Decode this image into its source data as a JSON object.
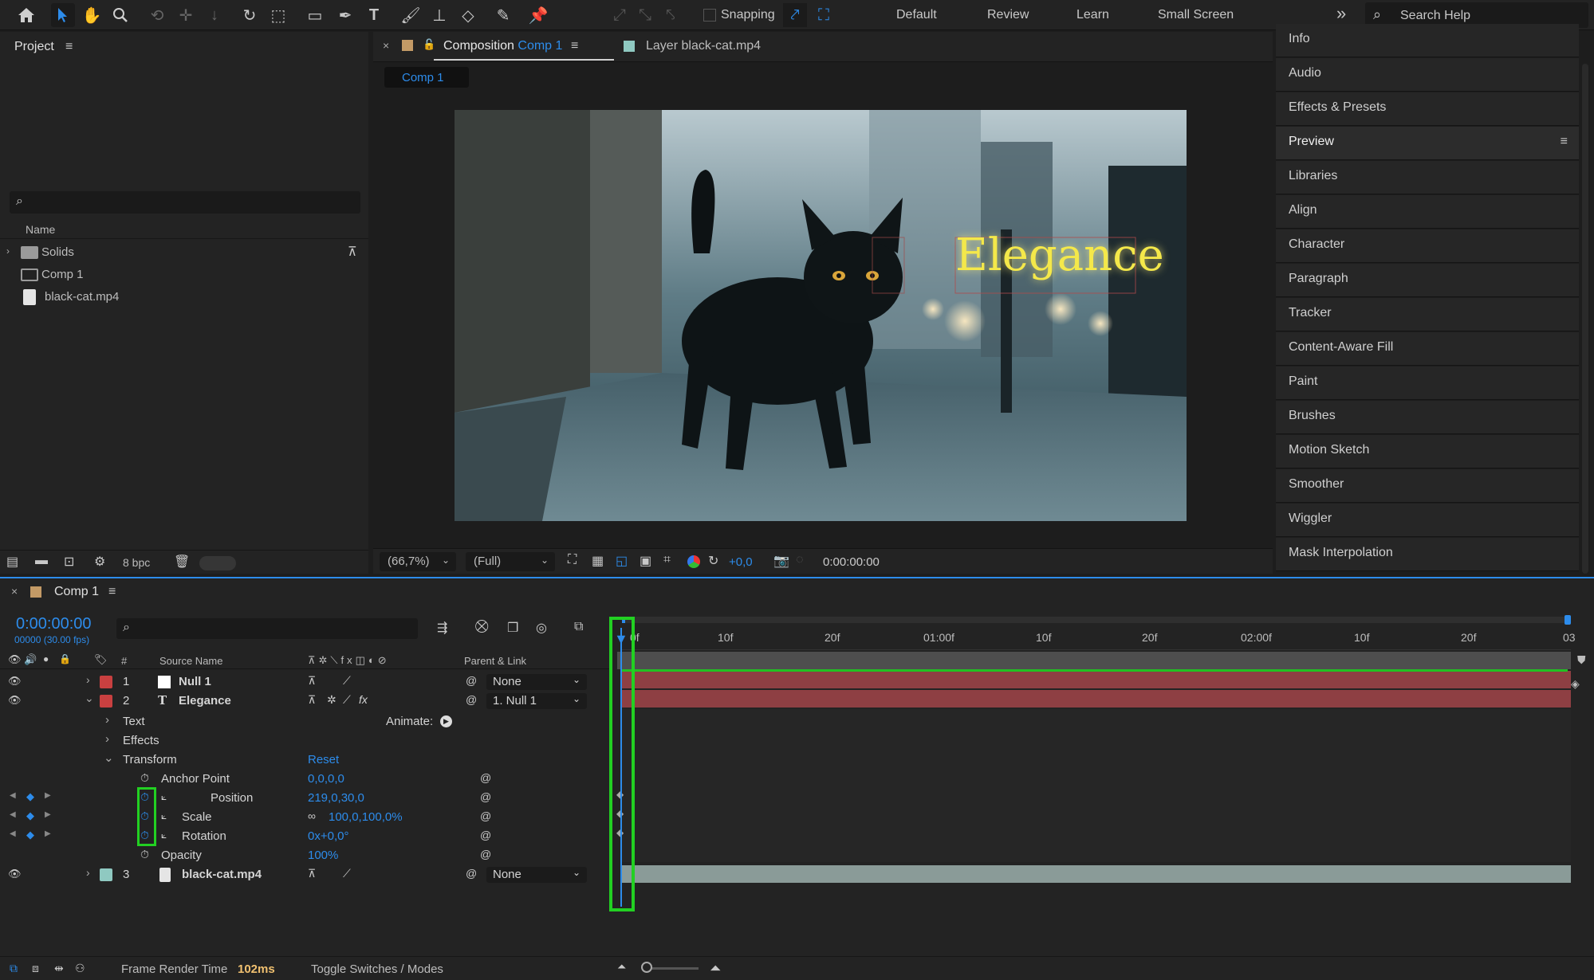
{
  "toolbar": {
    "snapping": "Snapping",
    "workspaces": [
      "Default",
      "Review",
      "Learn",
      "Small Screen"
    ],
    "more": "»",
    "search_placeholder": "Search Help"
  },
  "project": {
    "title": "Project",
    "column_name": "Name",
    "items": [
      {
        "name": "Solids",
        "type": "folder"
      },
      {
        "name": "Comp 1",
        "type": "composition"
      },
      {
        "name": "black-cat.mp4",
        "type": "footage"
      }
    ],
    "bpc": "8 bpc"
  },
  "composition": {
    "tab_prefix": "Composition",
    "tab_name": "Comp 1",
    "layer_tab_prefix": "Layer",
    "layer_tab_name": "black-cat.mp4",
    "breadcrumb": "Comp 1",
    "overlay_text": "Elegance",
    "zoom": "(66,7%)",
    "resolution": "(Full)",
    "exposure": "+0,0",
    "timecode": "0:00:00:00"
  },
  "right_panels": [
    "Info",
    "Audio",
    "Effects & Presets",
    "Preview",
    "Libraries",
    "Align",
    "Character",
    "Paragraph",
    "Tracker",
    "Content-Aware Fill",
    "Paint",
    "Brushes",
    "Motion Sketch",
    "Smoother",
    "Wiggler",
    "Mask Interpolation"
  ],
  "timeline": {
    "tab_name": "Comp 1",
    "current_time": "0:00:00:00",
    "frame_info": "00000 (30.00 fps)",
    "col_hash": "#",
    "col_source": "Source Name",
    "col_parent": "Parent & Link",
    "ruler_labels": [
      "0f",
      "10f",
      "20f",
      "01:00f",
      "10f",
      "20f",
      "02:00f",
      "10f",
      "20f",
      "03"
    ],
    "layers": [
      {
        "num": "1",
        "name": "Null 1",
        "parent": "None",
        "color": "#c94040"
      },
      {
        "num": "2",
        "name": "Elegance",
        "parent": "1. Null 1",
        "color": "#c94040"
      },
      {
        "num": "3",
        "name": "black-cat.mp4",
        "parent": "None",
        "color": "#8fc9c1"
      }
    ],
    "text_group": "Text",
    "animate_label": "Animate:",
    "effects_group": "Effects",
    "transform_group": "Transform",
    "reset": "Reset",
    "properties": [
      {
        "name": "Anchor Point",
        "value": "0,0,0,0"
      },
      {
        "name": "Position",
        "value": "219,0,30,0"
      },
      {
        "name": "Scale",
        "value": "100,0,100,0%"
      },
      {
        "name": "Rotation",
        "value": "0x+0,0°"
      },
      {
        "name": "Opacity",
        "value": "100%"
      }
    ],
    "footer_render_label": "Frame Render Time",
    "footer_render_value": "102ms",
    "footer_toggle": "Toggle Switches / Modes"
  },
  "colors": {
    "accent": "#2d8ceb",
    "highlight": "#22d022",
    "layer_bar_red": "#8e3f43",
    "layer_bar_teal": "#8a9b98"
  }
}
